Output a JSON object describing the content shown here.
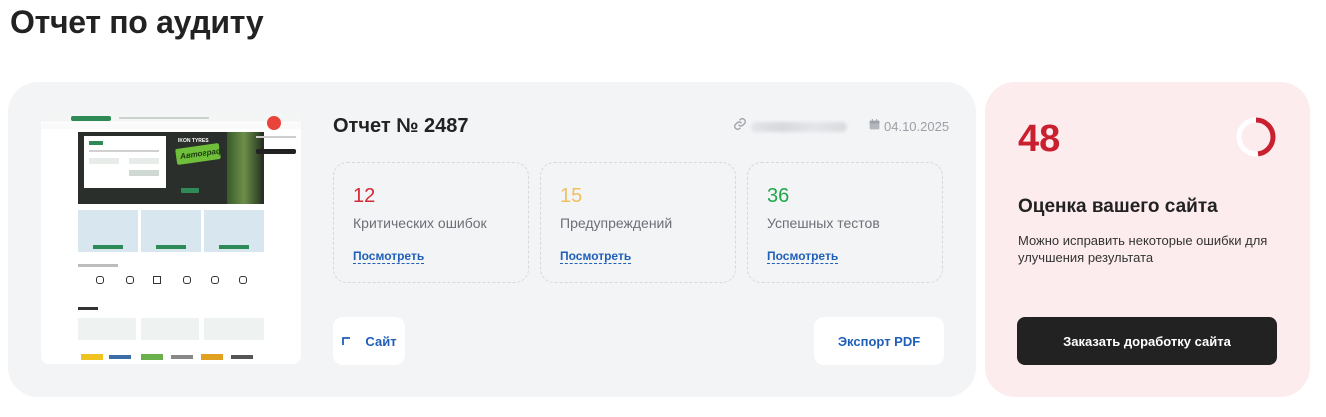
{
  "page": {
    "title": "Отчет по аудиту"
  },
  "report": {
    "title": "Отчет № 2487",
    "date": "04.10.2025"
  },
  "stats": [
    {
      "value": "12",
      "label": "Критических ошибок",
      "link": "Посмотреть",
      "color": "#d12a35"
    },
    {
      "value": "15",
      "label": "Предупреждений",
      "link": "Посмотреть",
      "color": "#f0c060"
    },
    {
      "value": "36",
      "label": "Успешных тестов",
      "link": "Посмотреть",
      "color": "#1fa84a"
    }
  ],
  "actions": {
    "site_label": "Сайт",
    "export_label": "Экспорт PDF"
  },
  "score": {
    "value": "48",
    "progress": 0.48,
    "title": "Оценка вашего сайта",
    "description": "Можно исправить некоторые ошибки для улучшения результата",
    "order_button": "Заказать доработку сайта",
    "accent": "#c8202f"
  },
  "thumbnail": {
    "brand": "IKON TYRES",
    "headline": "Автограф"
  },
  "icons": {
    "link": "link-icon",
    "calendar": "calendar-icon",
    "arrow": "arrow-up-left-icon"
  }
}
